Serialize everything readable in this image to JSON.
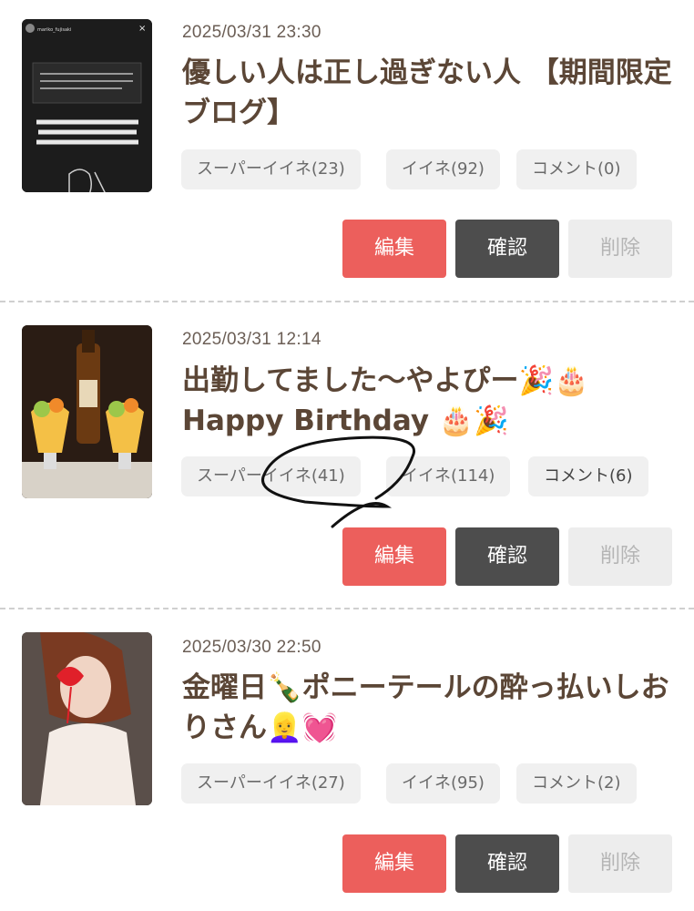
{
  "posts": [
    {
      "date": "2025/03/31 23:30",
      "title": "優しい人は正し過ぎない人 【期間限定ブログ】",
      "thumb_text": {
        "username": "mariko_fujisaki",
        "quote": "基本女の子、ドレスだと思うのですが、着物の方が出勤すると着物でもよろしいでしょうか。",
        "main": "卸下されると思います\n着たい服を着てると\nあまり人気が出ません"
      },
      "super_like": "スーパーイイネ(23)",
      "like": "イイネ(92)",
      "comment": "コメント(0)"
    },
    {
      "date": "2025/03/31 12:14",
      "title": "出勤してました〜やよぴー🎉🎂 Happy Birthday 🎂🎉",
      "super_like": "スーパーイイネ(41)",
      "like": "イイネ(114)",
      "comment": "コメント(6)"
    },
    {
      "date": "2025/03/30 22:50",
      "title": "金曜日🍾ポニーテールの酔っ払いしおりさん👱‍♀️💓",
      "super_like": "スーパーイイネ(27)",
      "like": "イイネ(95)",
      "comment": "コメント(2)"
    }
  ],
  "buttons": {
    "edit": "編集",
    "confirm": "確認",
    "delete": "削除"
  },
  "colors": {
    "edit": "#ec5f5c",
    "confirm": "#4d4d4d",
    "delete": "#ededed"
  }
}
